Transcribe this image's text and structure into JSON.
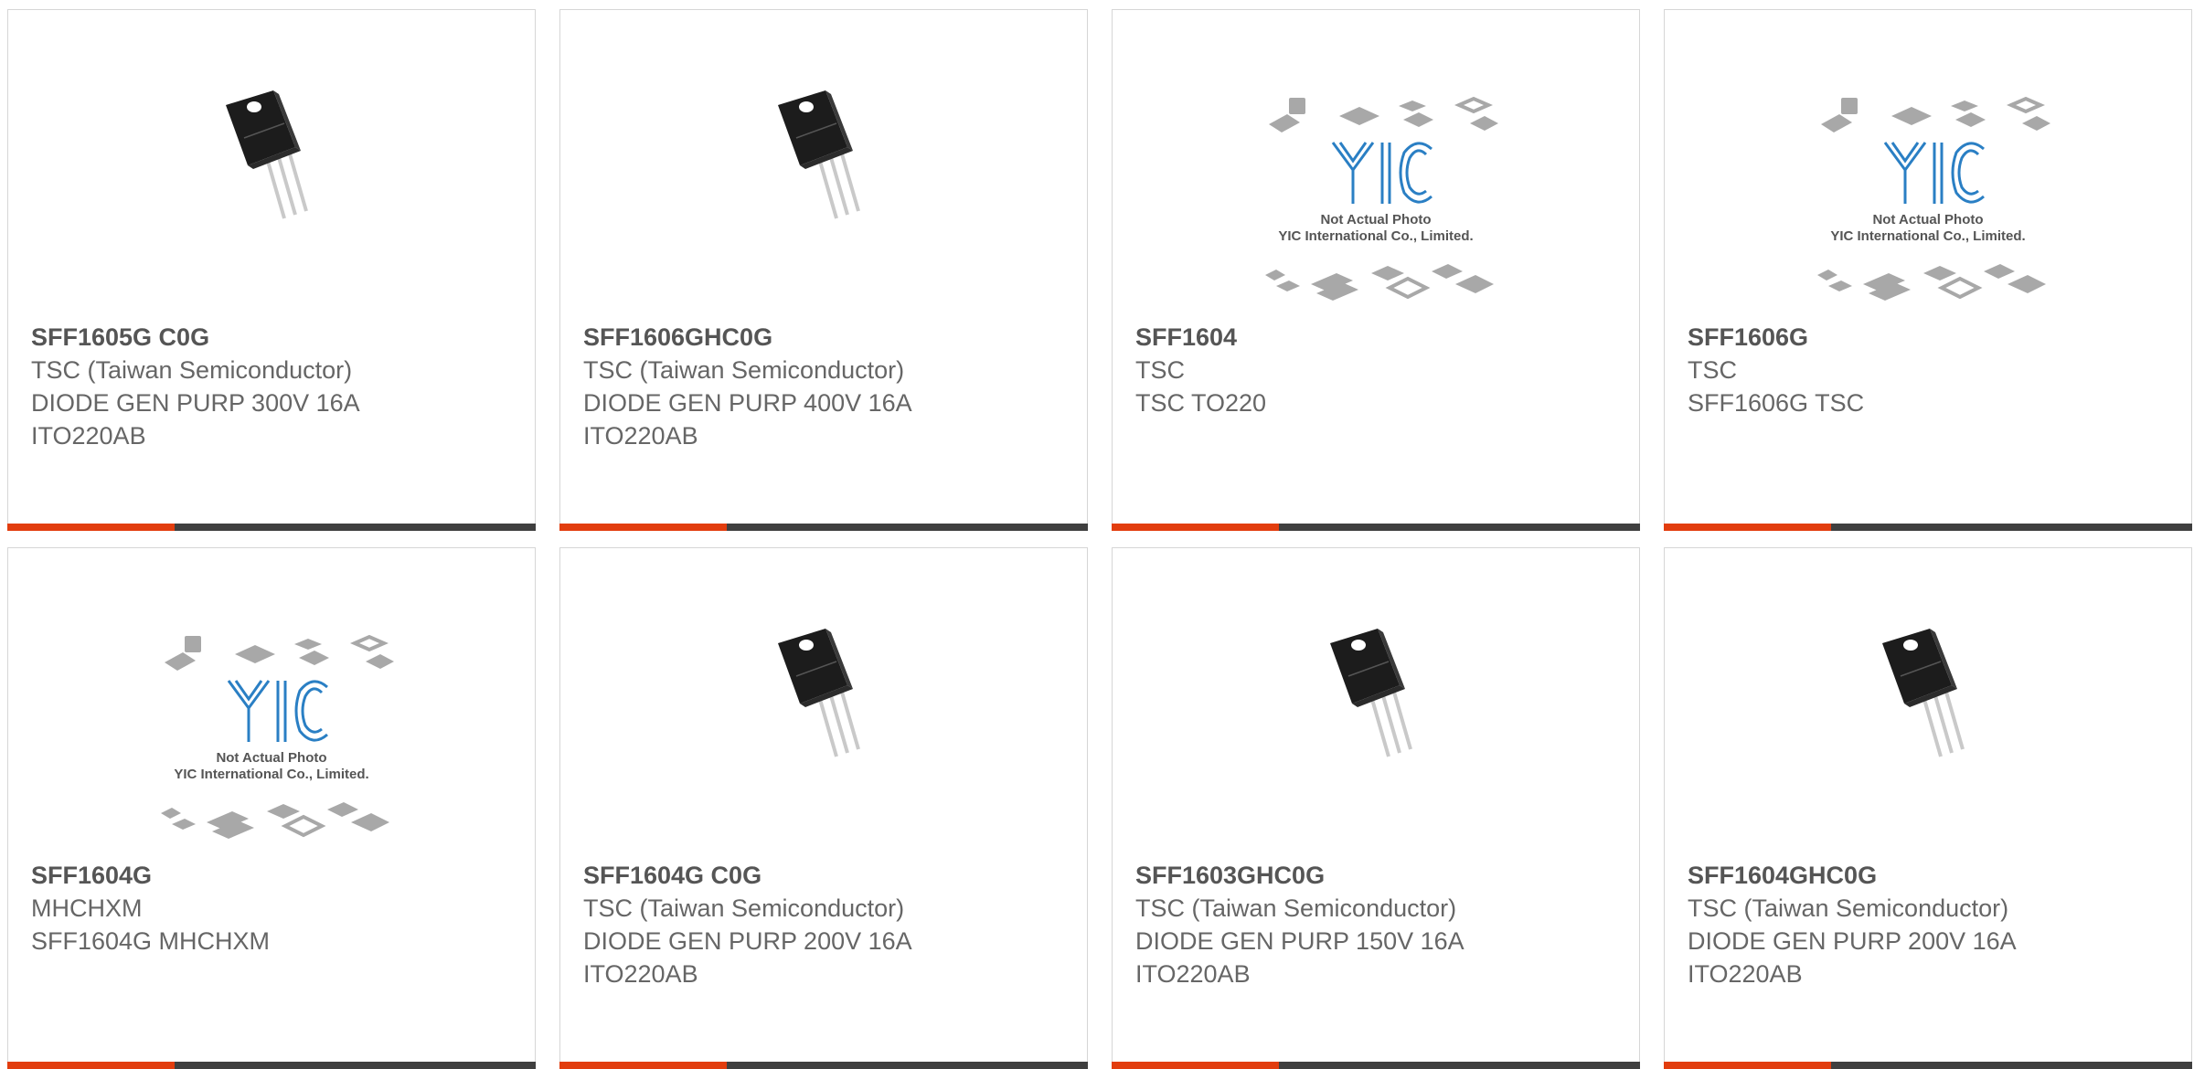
{
  "colors": {
    "accent": "#e23d0e",
    "bar": "#3f3f3f",
    "text": "#666666",
    "title": "#555555",
    "border": "#d6d6d6"
  },
  "products": [
    {
      "part": "SFF1605G C0G",
      "manufacturer": "TSC (Taiwan Semiconductor)",
      "desc1": "DIODE GEN PURP 300V 16A",
      "desc2": "ITO220AB",
      "image": "to220-transistor-icon"
    },
    {
      "part": "SFF1606GHC0G",
      "manufacturer": "TSC (Taiwan Semiconductor)",
      "desc1": "DIODE GEN PURP 400V 16A",
      "desc2": "ITO220AB",
      "image": "to220-transistor-icon"
    },
    {
      "part": "SFF1604",
      "manufacturer": "TSC",
      "desc1": "TSC TO220",
      "desc2": "",
      "image": "yic-placeholder-logo"
    },
    {
      "part": "SFF1606G",
      "manufacturer": "TSC",
      "desc1": "SFF1606G TSC",
      "desc2": "",
      "image": "yic-placeholder-logo"
    },
    {
      "part": "SFF1604G",
      "manufacturer": "MHCHXM",
      "desc1": "SFF1604G MHCHXM",
      "desc2": "",
      "image": "yic-placeholder-logo"
    },
    {
      "part": "SFF1604G C0G",
      "manufacturer": "TSC (Taiwan Semiconductor)",
      "desc1": "DIODE GEN PURP 200V 16A",
      "desc2": "ITO220AB",
      "image": "to220-transistor-icon"
    },
    {
      "part": "SFF1603GHC0G",
      "manufacturer": "TSC (Taiwan Semiconductor)",
      "desc1": "DIODE GEN PURP 150V 16A",
      "desc2": "ITO220AB",
      "image": "to220-transistor-icon"
    },
    {
      "part": "SFF1604GHC0G",
      "manufacturer": "TSC (Taiwan Semiconductor)",
      "desc1": "DIODE GEN PURP 200V 16A",
      "desc2": "ITO220AB",
      "image": "to220-transistor-icon"
    }
  ],
  "placeholder": {
    "line1": "Not Actual Photo",
    "line2": "YIC International Co., Limited."
  }
}
